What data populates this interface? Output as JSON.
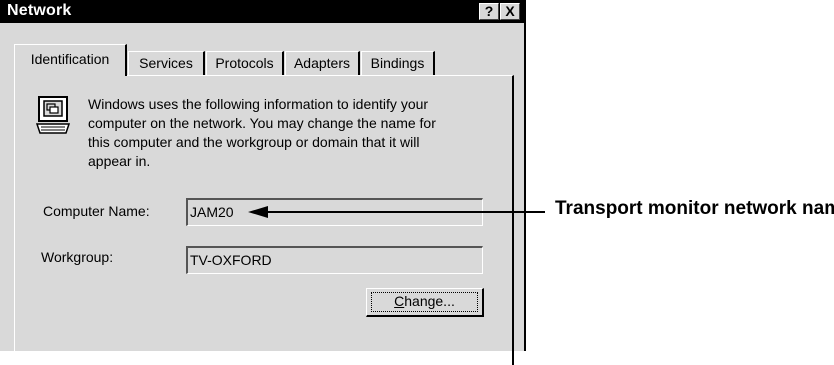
{
  "window": {
    "title": "Network",
    "help_button": "?",
    "close_button": "X"
  },
  "tabs": [
    {
      "label": "Identification",
      "active": true
    },
    {
      "label": "Services"
    },
    {
      "label": "Protocols"
    },
    {
      "label": "Adapters"
    },
    {
      "label": "Bindings"
    }
  ],
  "info": {
    "icon": "computer-icon",
    "lines": [
      "Windows uses the following information to identify your",
      "computer on the network.  You may change the name for",
      "this computer and the workgroup or domain that it will",
      "appear in."
    ]
  },
  "fields": {
    "computer_name_label": "Computer Name:",
    "computer_name_value": "JAM20",
    "workgroup_label": "Workgroup:",
    "workgroup_value": "TV-OXFORD"
  },
  "buttons": {
    "change_prefix": "",
    "change_underlined": "C",
    "change_rest": "hange..."
  },
  "callout": {
    "text": "Transport monitor network name"
  }
}
